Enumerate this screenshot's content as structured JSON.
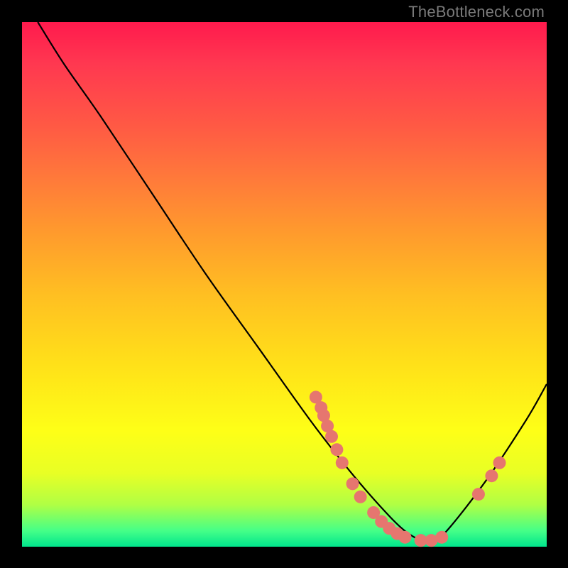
{
  "watermark": "TheBottleneck.com",
  "chart_data": {
    "type": "line",
    "title": "",
    "xlabel": "",
    "ylabel": "",
    "xlim": [
      0,
      100
    ],
    "ylim": [
      0,
      100
    ],
    "gradient_colors": {
      "top": "#ff1a4d",
      "mid_upper": "#ff9a2d",
      "mid_lower": "#feff17",
      "bottom": "#00e58c"
    },
    "series": [
      {
        "name": "bottleneck-curve",
        "color": "#000000",
        "x": [
          3,
          8,
          15,
          25,
          35,
          45,
          55,
          62,
          68,
          73,
          77,
          80,
          88,
          96,
          100
        ],
        "y": [
          100,
          92,
          82,
          67,
          52,
          38,
          24,
          15,
          8,
          3,
          1,
          2,
          12,
          24,
          31
        ]
      }
    ],
    "scatter_points": {
      "name": "highlighted-points",
      "color": "#e6766f",
      "radius_px": 9,
      "points": [
        {
          "x": 56.0,
          "y": 28.5
        },
        {
          "x": 57.0,
          "y": 26.5
        },
        {
          "x": 57.5,
          "y": 25.0
        },
        {
          "x": 58.2,
          "y": 23.0
        },
        {
          "x": 59.0,
          "y": 21.0
        },
        {
          "x": 60.0,
          "y": 18.5
        },
        {
          "x": 61.0,
          "y": 16.0
        },
        {
          "x": 63.0,
          "y": 12.0
        },
        {
          "x": 64.5,
          "y": 9.5
        },
        {
          "x": 67.0,
          "y": 6.5
        },
        {
          "x": 68.5,
          "y": 4.8
        },
        {
          "x": 70.0,
          "y": 3.5
        },
        {
          "x": 71.5,
          "y": 2.5
        },
        {
          "x": 73.0,
          "y": 1.8
        },
        {
          "x": 76.0,
          "y": 1.2
        },
        {
          "x": 78.0,
          "y": 1.2
        },
        {
          "x": 80.0,
          "y": 1.8
        },
        {
          "x": 87.0,
          "y": 10.0
        },
        {
          "x": 89.5,
          "y": 13.5
        },
        {
          "x": 91.0,
          "y": 16.0
        }
      ]
    }
  }
}
